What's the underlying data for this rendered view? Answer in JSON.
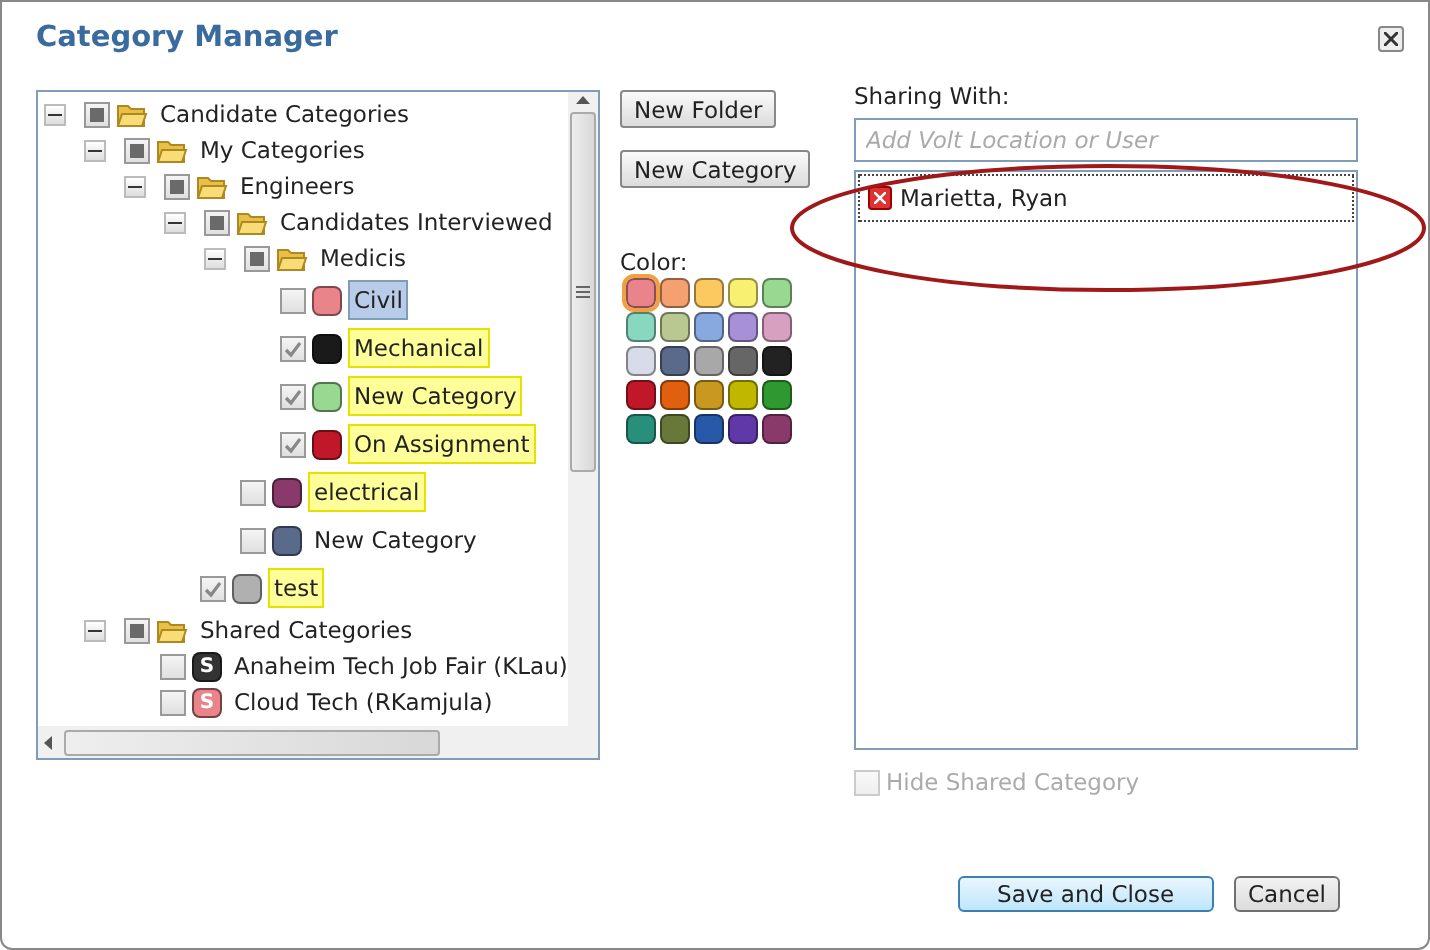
{
  "window": {
    "title": "Category Manager"
  },
  "tree": [
    {
      "kind": "folder",
      "label": "Candidate Categories",
      "checked": false,
      "partial": true,
      "expanded": true,
      "children": [
        {
          "kind": "folder",
          "label": "My Categories",
          "checked": false,
          "partial": true,
          "expanded": true,
          "children": [
            {
              "kind": "folder",
              "label": "Engineers",
              "checked": false,
              "partial": true,
              "expanded": true,
              "children": [
                {
                  "kind": "folder",
                  "label": "Candidates Interviewed",
                  "checked": false,
                  "partial": true,
                  "expanded": true,
                  "children": [
                    {
                      "kind": "folder",
                      "label": "Medicis",
                      "checked": false,
                      "partial": true,
                      "expanded": true,
                      "children": [
                        {
                          "kind": "category",
                          "label": "Civil",
                          "checked": false,
                          "color": "#e8848a",
                          "highlighted": false,
                          "selected": true
                        },
                        {
                          "kind": "category",
                          "label": "Mechanical",
                          "checked": true,
                          "color": "#1a1a1a",
                          "highlighted": true,
                          "selected": false
                        },
                        {
                          "kind": "category",
                          "label": "New Category",
                          "checked": true,
                          "color": "#98d890",
                          "highlighted": true,
                          "selected": false
                        },
                        {
                          "kind": "category",
                          "label": "On Assignment",
                          "checked": true,
                          "color": "#c01828",
                          "highlighted": true,
                          "selected": false
                        }
                      ]
                    },
                    {
                      "kind": "category",
                      "label": "electrical",
                      "checked": false,
                      "color": "#8a3a6a",
                      "highlighted": true,
                      "selected": false
                    },
                    {
                      "kind": "category",
                      "label": "New Category",
                      "checked": false,
                      "color": "#5a6a8a",
                      "highlighted": false,
                      "selected": false
                    }
                  ]
                },
                {
                  "kind": "category",
                  "label": "test",
                  "checked": true,
                  "color": "#b0b0b0",
                  "highlighted": true,
                  "selected": false
                }
              ]
            }
          ]
        },
        {
          "kind": "folder",
          "label": "Shared Categories",
          "checked": false,
          "partial": true,
          "expanded": true,
          "children": [
            {
              "kind": "shared",
              "label": "Anaheim Tech Job Fair (KLau)",
              "checked": false,
              "color": "#333333",
              "badge": "S",
              "highlighted": false,
              "selected": false
            },
            {
              "kind": "shared",
              "label": "Cloud Tech (RKamjula)",
              "checked": false,
              "color": "#e8848a",
              "badge": "S",
              "highlighted": false,
              "selected": false
            }
          ]
        }
      ]
    }
  ],
  "tools": [
    "New Folder",
    "New Category"
  ],
  "palette": {
    "label": "Color:",
    "swatches": [
      {
        "color": "#e8848a",
        "selected": true
      },
      {
        "color": "#f4a070",
        "selected": false
      },
      {
        "color": "#fcc860",
        "selected": false
      },
      {
        "color": "#f8f070",
        "selected": false
      },
      {
        "color": "#98d890",
        "selected": false
      },
      {
        "color": "#88d8c0",
        "selected": false
      },
      {
        "color": "#b8c890",
        "selected": false
      },
      {
        "color": "#88a8e0",
        "selected": false
      },
      {
        "color": "#a890d8",
        "selected": false
      },
      {
        "color": "#d8a0c0",
        "selected": false
      },
      {
        "color": "#d8dce8",
        "selected": false
      },
      {
        "color": "#5a6a8a",
        "selected": false
      },
      {
        "color": "#a8a8a8",
        "selected": false
      },
      {
        "color": "#666666",
        "selected": false
      },
      {
        "color": "#222222",
        "selected": false
      },
      {
        "color": "#c01828",
        "selected": false
      },
      {
        "color": "#e06010",
        "selected": false
      },
      {
        "color": "#c89820",
        "selected": false
      },
      {
        "color": "#c0b800",
        "selected": false
      },
      {
        "color": "#309830",
        "selected": false
      },
      {
        "color": "#28907a",
        "selected": false
      },
      {
        "color": "#687838",
        "selected": false
      },
      {
        "color": "#2858a8",
        "selected": false
      },
      {
        "color": "#6038a8",
        "selected": false
      },
      {
        "color": "#8a3a6a",
        "selected": false
      }
    ]
  },
  "sharing": {
    "label": "Sharing With:",
    "placeholder": "Add Volt Location or User",
    "users": [
      {
        "name": "Marietta, Ryan"
      }
    ]
  },
  "hide_shared": {
    "label": "Hide Shared Category",
    "checked": false,
    "disabled": true
  },
  "buttons": [
    {
      "label": "Save and Close",
      "primary": true
    },
    {
      "label": "Cancel",
      "primary": false
    }
  ]
}
